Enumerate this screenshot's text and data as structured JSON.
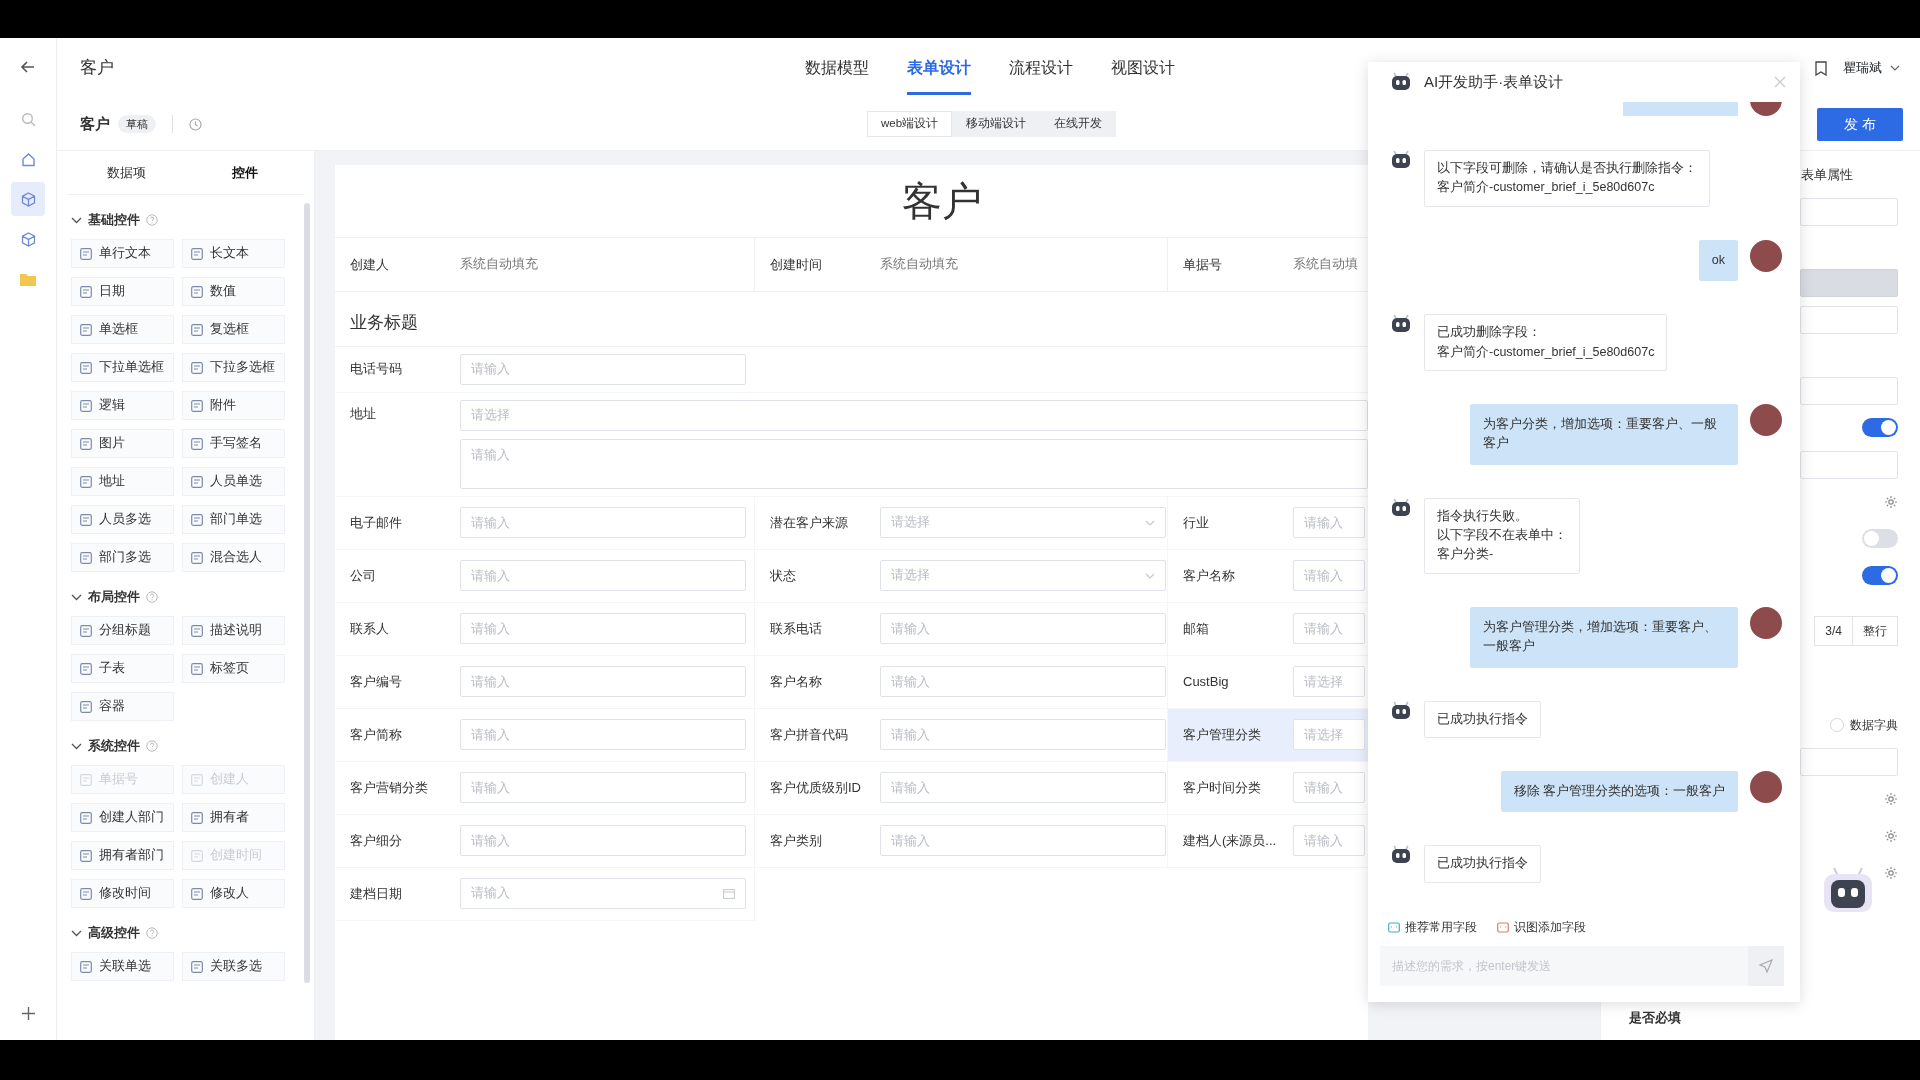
{
  "rail": [
    {
      "selected": false
    },
    {
      "selected": false
    },
    {
      "selected": false
    },
    {
      "selected": true
    },
    {
      "selected": false
    },
    {
      "selected": false
    },
    {
      "selected": false
    }
  ],
  "header": {
    "title": "客户",
    "tabs": [
      {
        "label": "数据模型",
        "selected": false
      },
      {
        "label": "表单设计",
        "selected": true
      },
      {
        "label": "流程设计",
        "selected": false
      },
      {
        "label": "视图设计",
        "selected": false
      }
    ],
    "user": "瞿瑞斌"
  },
  "subheader": {
    "title": "客户",
    "badge": "草稿",
    "modes": [
      {
        "label": "web端设计",
        "selected": true
      },
      {
        "label": "移动端设计",
        "selected": false
      },
      {
        "label": "在线开发",
        "selected": false
      }
    ],
    "publish": "发 布"
  },
  "palette": {
    "tabs": [
      {
        "label": "数据项",
        "selected": false
      },
      {
        "label": "控件",
        "selected": true
      }
    ],
    "groups": [
      {
        "title": "基础控件",
        "expanded": true,
        "items": [
          {
            "label": "单行文本",
            "disabled": false
          },
          {
            "label": "长文本",
            "disabled": false
          },
          {
            "label": "日期",
            "disabled": false
          },
          {
            "label": "数值",
            "disabled": false
          },
          {
            "label": "单选框",
            "disabled": false
          },
          {
            "label": "复选框",
            "disabled": false
          },
          {
            "label": "下拉单选框",
            "disabled": false
          },
          {
            "label": "下拉多选框",
            "disabled": false
          },
          {
            "label": "逻辑",
            "disabled": false
          },
          {
            "label": "附件",
            "disabled": false
          },
          {
            "label": "图片",
            "disabled": false
          },
          {
            "label": "手写签名",
            "disabled": false
          },
          {
            "label": "地址",
            "disabled": false
          },
          {
            "label": "人员单选",
            "disabled": false
          },
          {
            "label": "人员多选",
            "disabled": false
          },
          {
            "label": "部门单选",
            "disabled": false
          },
          {
            "label": "部门多选",
            "disabled": false
          },
          {
            "label": "混合选人",
            "disabled": false
          }
        ]
      },
      {
        "title": "布局控件",
        "expanded": true,
        "items": [
          {
            "label": "分组标题",
            "disabled": false
          },
          {
            "label": "描述说明",
            "disabled": false
          },
          {
            "label": "子表",
            "disabled": false
          },
          {
            "label": "标签页",
            "disabled": false
          },
          {
            "label": "容器",
            "disabled": false
          }
        ]
      },
      {
        "title": "系统控件",
        "expanded": true,
        "items": [
          {
            "label": "单据号",
            "disabled": true
          },
          {
            "label": "创建人",
            "disabled": true
          },
          {
            "label": "创建人部门",
            "disabled": false
          },
          {
            "label": "拥有者",
            "disabled": false
          },
          {
            "label": "拥有者部门",
            "disabled": false
          },
          {
            "label": "创建时间",
            "disabled": true
          },
          {
            "label": "修改时间",
            "disabled": false
          },
          {
            "label": "修改人",
            "disabled": false
          }
        ]
      },
      {
        "title": "高级控件",
        "expanded": true,
        "items": [
          {
            "label": "关联单选",
            "disabled": false
          },
          {
            "label": "关联多选",
            "disabled": false
          }
        ]
      }
    ]
  },
  "form": {
    "title": "客户",
    "system": [
      {
        "label": "创建人",
        "value": "系统自动填充"
      },
      {
        "label": "创建时间",
        "value": "系统自动填充"
      },
      {
        "label": "单据号",
        "value": "系统自动填"
      }
    ],
    "section": "业务标题",
    "phone": {
      "label": "电话号码",
      "placeholder": "请输入"
    },
    "address": {
      "label": "地址",
      "select_placeholder": "请选择",
      "detail_placeholder": "请输入"
    },
    "fields": [
      {
        "label": "电子邮件",
        "kind": "input",
        "placeholder": "请输入",
        "selected": false
      },
      {
        "label": "潜在客户来源",
        "kind": "select",
        "placeholder": "请选择",
        "selected": false
      },
      {
        "label": "行业",
        "kind": "input",
        "placeholder": "请输入",
        "selected": false
      },
      {
        "label": "公司",
        "kind": "input",
        "placeholder": "请输入",
        "selected": false
      },
      {
        "label": "状态",
        "kind": "select",
        "placeholder": "请选择",
        "selected": false
      },
      {
        "label": "客户名称",
        "kind": "input",
        "placeholder": "请输入",
        "selected": false
      },
      {
        "label": "联系人",
        "kind": "input",
        "placeholder": "请输入",
        "selected": false
      },
      {
        "label": "联系电话",
        "kind": "input",
        "placeholder": "请输入",
        "selected": false
      },
      {
        "label": "邮箱",
        "kind": "input",
        "placeholder": "请输入",
        "selected": false
      },
      {
        "label": "客户编号",
        "kind": "input",
        "placeholder": "请输入",
        "selected": false
      },
      {
        "label": "客户名称",
        "kind": "input",
        "placeholder": "请输入",
        "selected": false
      },
      {
        "label": "CustBig",
        "kind": "input",
        "placeholder": "请选择",
        "selected": false
      },
      {
        "label": "客户简称",
        "kind": "input",
        "placeholder": "请输入",
        "selected": false
      },
      {
        "label": "客户拼音代码",
        "kind": "input",
        "placeholder": "请输入",
        "selected": false
      },
      {
        "label": "客户管理分类",
        "kind": "input",
        "placeholder": "请选择",
        "selected": true
      },
      {
        "label": "客户营销分类",
        "kind": "input",
        "placeholder": "请输入",
        "selected": false
      },
      {
        "label": "客户优质级别ID",
        "kind": "input",
        "placeholder": "请输入",
        "selected": false
      },
      {
        "label": "客户时间分类",
        "kind": "input",
        "placeholder": "请输入",
        "selected": false
      },
      {
        "label": "客户细分",
        "kind": "input",
        "placeholder": "请输入",
        "selected": false
      },
      {
        "label": "客户类别",
        "kind": "input",
        "placeholder": "请输入",
        "selected": false
      },
      {
        "label": "建档人(来源员...",
        "kind": "input",
        "placeholder": "请输入",
        "selected": false
      },
      {
        "label": "建档日期",
        "kind": "date",
        "placeholder": "请输入",
        "selected": false
      }
    ]
  },
  "assistant": {
    "title": "AI开发助手·表单设计",
    "messages": [
      {
        "kind": "bot",
        "lines": [
          "以下字段可删除，请确认是否执行删除指令：",
          "客户简介-customer_brief_i_5e80d607c"
        ]
      },
      {
        "kind": "user",
        "lines": [
          "ok"
        ]
      },
      {
        "kind": "bot",
        "lines": [
          "已成功删除字段：",
          "客户简介-customer_brief_i_5e80d607c"
        ]
      },
      {
        "kind": "user",
        "lines": [
          "为客户分类，增加选项：重要客户、一般客户"
        ]
      },
      {
        "kind": "bot",
        "lines": [
          "指令执行失败。",
          "以下字段不在表单中：",
          "客户分类-"
        ]
      },
      {
        "kind": "user",
        "lines": [
          "为客户管理分类，增加选项：重要客户、一般客户"
        ]
      },
      {
        "kind": "bot",
        "lines": [
          "已成功执行指令"
        ]
      },
      {
        "kind": "user",
        "lines": [
          "移除 客户管理分类的选项：一般客户"
        ]
      },
      {
        "kind": "bot",
        "lines": [
          "已成功执行指令"
        ]
      }
    ],
    "actions": [
      "推荐常用字段",
      "识图添加字段"
    ],
    "input": {
      "placeholder": "描述您的需求，按enter键发送"
    }
  },
  "properties": {
    "heading": "表单属性",
    "items": [
      {
        "kind": "input",
        "disabled": false
      },
      {
        "kind": "input",
        "disabled": true
      },
      {
        "kind": "input",
        "disabled": false
      },
      {
        "kind": "input",
        "disabled": false
      },
      {
        "kind": "toggle",
        "on": true
      },
      {
        "kind": "input",
        "disabled": false
      },
      {
        "kind": "gear"
      },
      {
        "kind": "toggle",
        "on": false
      },
      {
        "kind": "toggle",
        "on": true
      },
      {
        "kind": "segmented",
        "options": [
          {
            "label": "3/4",
            "selected": false
          },
          {
            "label": "整行",
            "selected": false
          }
        ]
      },
      {
        "kind": "radio",
        "label": "数据字典",
        "checked": false
      },
      {
        "kind": "input",
        "disabled": false
      },
      {
        "kind": "gear"
      },
      {
        "kind": "gear"
      },
      {
        "kind": "gear"
      }
    ],
    "footer": "是否必填"
  }
}
